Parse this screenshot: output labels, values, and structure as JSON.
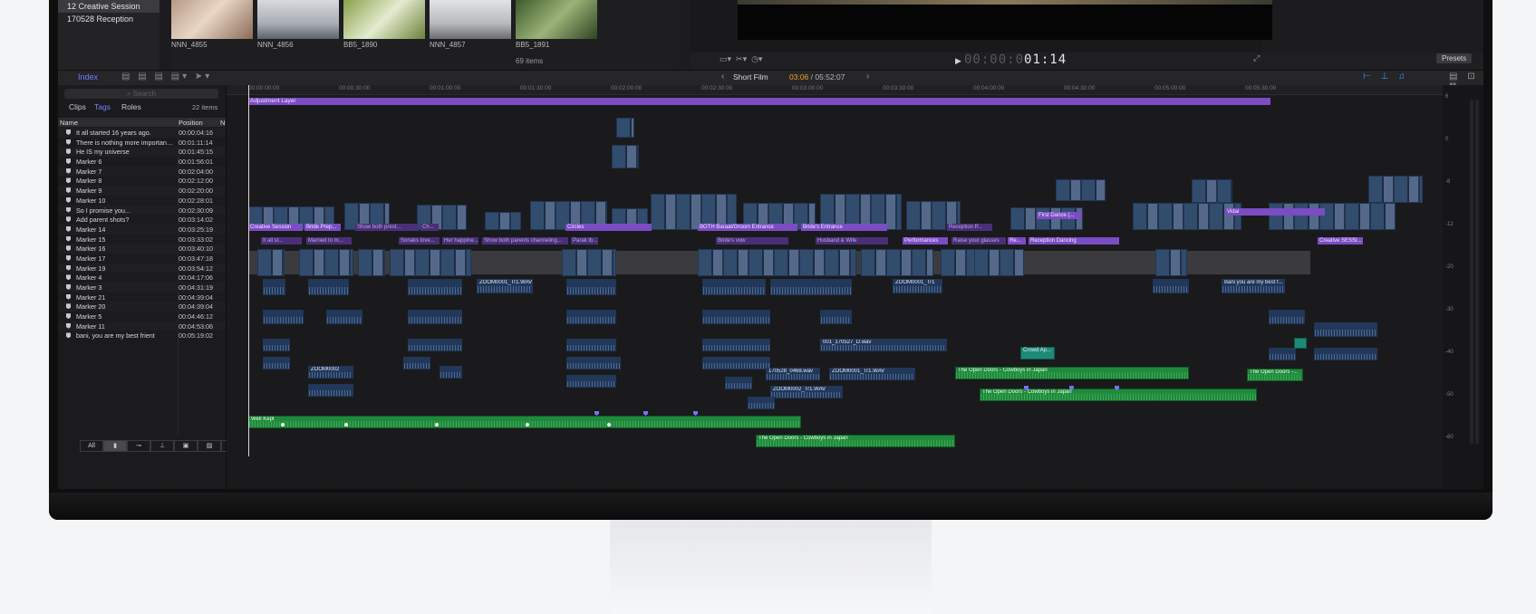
{
  "library": {
    "items": [
      {
        "label": "12 Creative Session",
        "selected": true
      },
      {
        "label": "170528 Reception",
        "selected": false
      }
    ]
  },
  "browser": {
    "thumbnails": [
      "NNN_4855",
      "NNN_4856",
      "BB5_1890",
      "NNN_4857",
      "BB5_1891"
    ],
    "items_count": "69 items"
  },
  "viewer": {
    "timecode_dim": "00:00:0",
    "timecode_lit": "01:14",
    "presets_label": "Presets"
  },
  "timeline_toolbar": {
    "index_label": "Index",
    "project_name": "Short Film",
    "current_time": "03:06",
    "duration": "/ 05:52:07"
  },
  "index_panel": {
    "search_placeholder": "Search",
    "tabs": [
      "Clips",
      "Tags",
      "Roles"
    ],
    "active_tab": "Tags",
    "count": "22 items",
    "columns": [
      "Name",
      "Position",
      "N"
    ],
    "rows": [
      {
        "name": "It all started 16 years ago.",
        "position": "00:00:04:16"
      },
      {
        "name": "There is nothing more important t...",
        "position": "00:01:11:14"
      },
      {
        "name": "He IS my universe",
        "position": "00:01:45:15"
      },
      {
        "name": "Marker 6",
        "position": "00:01:56:01"
      },
      {
        "name": "Marker 7",
        "position": "00:02:04:00"
      },
      {
        "name": "Marker 8",
        "position": "00:02:12:00"
      },
      {
        "name": "Marker 9",
        "position": "00:02:20:00"
      },
      {
        "name": "Marker 10",
        "position": "00:02:28:01"
      },
      {
        "name": "So I promise you...",
        "position": "00:02:30:09"
      },
      {
        "name": "Add parent shots?",
        "position": "00:03:14:02"
      },
      {
        "name": "Marker 14",
        "position": "00:03:25:19"
      },
      {
        "name": "Marker 15",
        "position": "00:03:33:02"
      },
      {
        "name": "Marker 16",
        "position": "00:03:40:10"
      },
      {
        "name": "Marker 17",
        "position": "00:03:47:18"
      },
      {
        "name": "Marker 19",
        "position": "00:03:54:12"
      },
      {
        "name": "Marker 4",
        "position": "00:04:17:06"
      },
      {
        "name": "Marker 3",
        "position": "00:04:31:19"
      },
      {
        "name": "Marker 21",
        "position": "00:04:39:04"
      },
      {
        "name": "Marker 20",
        "position": "00:04:39:04"
      },
      {
        "name": "Marker 5",
        "position": "00:04:46:12"
      },
      {
        "name": "Marker 11",
        "position": "00:04:53:06"
      },
      {
        "name": "bani, you are my best frient",
        "position": "00:05:19:02"
      }
    ],
    "bottom_tabs": [
      "All"
    ]
  },
  "ruler": [
    "00:00:00:00",
    "00:00:30:00",
    "00:01:00:00",
    "00:01:30:00",
    "00:02:00:00",
    "00:02:30:00",
    "00:03:00:00",
    "00:03:30:00",
    "00:04:00:00",
    "00:04:30:00",
    "00:05:00:00",
    "00:05:30:00"
  ],
  "timeline": {
    "adjustment_layer": "Adjustment Layer",
    "titles": [
      "Creative Session",
      "Bride Prep...",
      "Circles",
      "BOTH Baraat/Groom Entrance",
      "Bride's Entrance",
      "First Dance (...",
      "Vidai",
      "Creative SESSI..."
    ],
    "dim_titles": [
      "It all st...",
      "Married to m...",
      "Show both prest...",
      "Ch...",
      "Sonaks love...",
      "Her happine...",
      "Show both parents channeling...",
      "Parak ib...",
      "Bride's vow",
      "Husband & Wife",
      "Performances",
      "Raise your glasses",
      "Re...",
      "Reception Dancing",
      "Reception P..."
    ],
    "audio_clips": [
      "ZOOM0001_Tr1.WAV",
      "ZOOM0001_Tr1",
      "ZOOM0001_Tr1.WAV",
      "ZOOM0002_Tr1.WAV",
      "ZOOM0002",
      "Bani you are my best f...",
      "Crowd Ap...",
      "001_170527_D.wav",
      "170528_0468.wav"
    ],
    "music": [
      "Well Kept",
      "The Open Doors - Cowboys in Japan",
      "The Open Doors - Cowboys in Japan",
      "The Open Doors - Cowboys in Japan",
      "The Open Doors -..."
    ]
  },
  "meter_scale": [
    "6",
    "0",
    "-6",
    "-12",
    "-20",
    "-30",
    "-40",
    "-50",
    "-60"
  ],
  "colors": {
    "purple": "#7b4cc4",
    "green": "#1f8a3b",
    "blue_clip": "#2d4a75",
    "accent": "#6f7dff",
    "timecode": "#f0a030"
  }
}
